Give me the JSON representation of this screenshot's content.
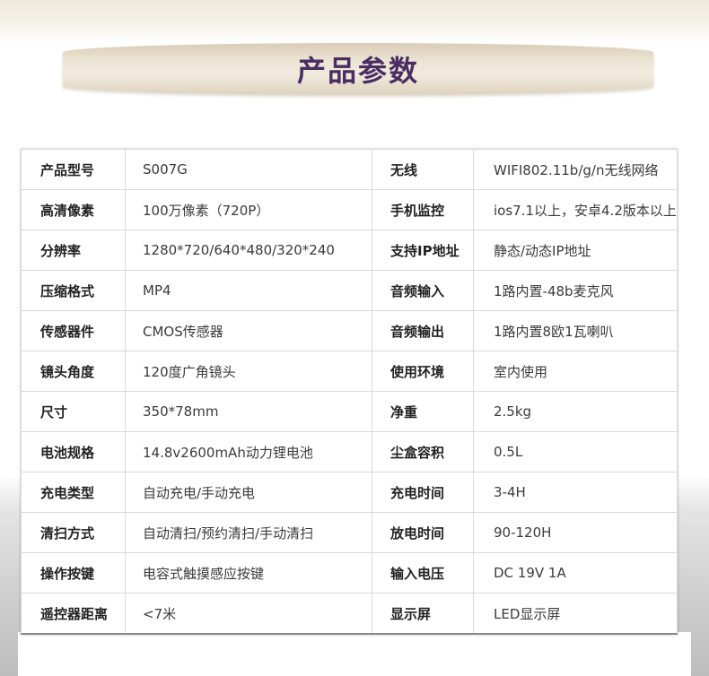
{
  "header": {
    "title": "产品参数"
  },
  "specs": [
    {
      "label1": "产品型号",
      "value1": "S007G",
      "label2": "无线",
      "value2": "WIFI802.11b/g/n无线网络"
    },
    {
      "label1": "高清像素",
      "value1": "100万像素（720P）",
      "label2": "手机监控",
      "value2": "ios7.1以上，安卓4.2版本以上"
    },
    {
      "label1": "分辨率",
      "value1": "1280*720/640*480/320*240",
      "label2": "支持IP地址",
      "value2": "静态/动态IP地址"
    },
    {
      "label1": "压缩格式",
      "value1": "MP4",
      "label2": "音频输入",
      "value2": "1路内置-48b麦克风"
    },
    {
      "label1": "传感器件",
      "value1": "CMOS传感器",
      "label2": "音频输出",
      "value2": "1路内置8欧1瓦喇叭"
    },
    {
      "label1": "镜头角度",
      "value1": "120度广角镜头",
      "label2": "使用环境",
      "value2": "室内使用"
    },
    {
      "label1": "尺寸",
      "value1": "350*78mm",
      "label2": "净重",
      "value2": "2.5kg"
    },
    {
      "label1": "电池规格",
      "value1": "14.8v2600mAh动力锂电池",
      "label2": "尘盒容积",
      "value2": "0.5L"
    },
    {
      "label1": "充电类型",
      "value1": "自动充电/手动充电",
      "label2": "充电时间",
      "value2": "3-4H"
    },
    {
      "label1": "清扫方式",
      "value1": "自动清扫/预约清扫/手动清扫",
      "label2": "放电时间",
      "value2": "90-120H"
    },
    {
      "label1": "操作按键",
      "value1": "电容式触摸感应按键",
      "label2": "输入电压",
      "value2": "DC 19V 1A"
    },
    {
      "label1": "遥控器距离",
      "value1": "<7米",
      "label2": "显示屏",
      "value2": "LED显示屏"
    }
  ]
}
